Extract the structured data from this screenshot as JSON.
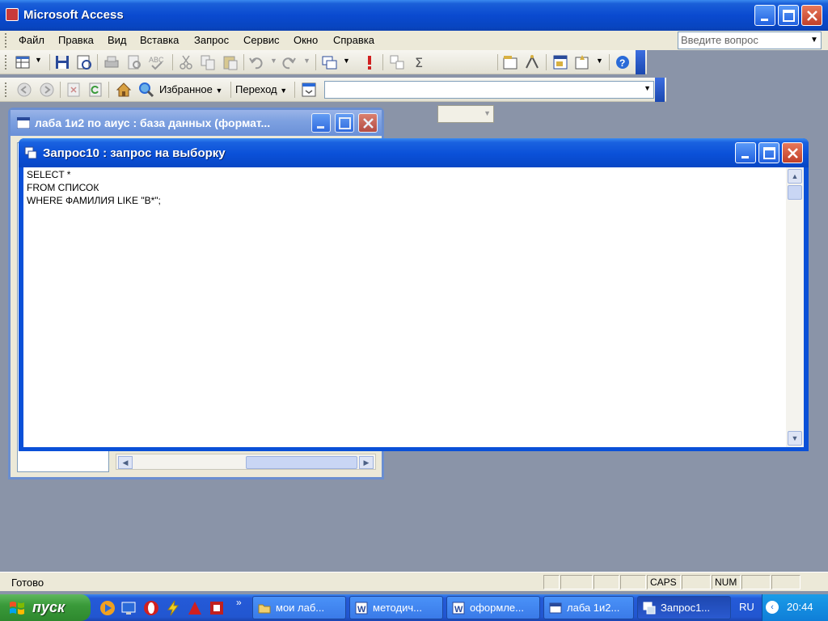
{
  "app": {
    "title": "Microsoft Access"
  },
  "menu": {
    "items": [
      {
        "label": "Файл"
      },
      {
        "label": "Правка"
      },
      {
        "label": "Вид"
      },
      {
        "label": "Вставка"
      },
      {
        "label": "Запрос"
      },
      {
        "label": "Сервис"
      },
      {
        "label": "Окно"
      },
      {
        "label": "Справка"
      }
    ],
    "ask_placeholder": "Введите вопрос"
  },
  "toolbar1": {
    "icons": [
      "view-icon",
      "save-icon",
      "properties-icon",
      "print-icon",
      "print-preview-icon",
      "spelling-icon",
      "cut-icon",
      "copy-icon",
      "paste-icon",
      "undo-icon",
      "redo-icon",
      "query-type-icon",
      "run-icon",
      "show-table-icon",
      "totals-icon",
      "top-values-icon",
      "properties-sheet-icon",
      "builder-icon",
      "database-window-icon",
      "new-object-icon",
      "help-icon"
    ]
  },
  "toolbar2": {
    "favorites_label": "Избранное",
    "go_label": "Переход",
    "icons": [
      "back-icon",
      "forward-icon",
      "stop-icon",
      "refresh-icon",
      "home-icon",
      "search-web-icon",
      "show-only-web-toolbar-icon"
    ]
  },
  "db_window": {
    "title": "лаба 1и2 по аиус : база данных (формат..."
  },
  "query_window": {
    "title": "Запрос10 : запрос на выборку",
    "sql_lines": [
      "SELECT *",
      "FROM СПИСОК",
      "WHERE ФАМИЛИЯ LIKE \"В*\";"
    ]
  },
  "statusbar": {
    "status": "Готово",
    "caps": "CAPS",
    "num": "NUM"
  },
  "taskbar": {
    "start_label": "пуск",
    "tasks": [
      {
        "label": "мои лаб...",
        "icon": "folder-icon"
      },
      {
        "label": "методич...",
        "icon": "word-icon"
      },
      {
        "label": "оформле...",
        "icon": "word-icon"
      },
      {
        "label": "лаба 1и2...",
        "icon": "access-db-icon"
      },
      {
        "label": "Запрос1...",
        "icon": "access-query-icon"
      }
    ],
    "language": "RU",
    "clock": "20:44"
  }
}
